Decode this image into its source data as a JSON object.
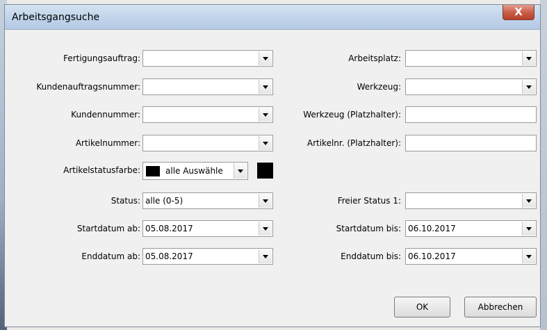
{
  "window": {
    "title": "Arbeitsgangsuche",
    "close_label": "X"
  },
  "left": {
    "fertigungsauftrag_label": "Fertigungsauftrag:",
    "kundenauftragsnummer_label": "Kundenauftragsnummer:",
    "kundennummer_label": "Kundennummer:",
    "artikelnummer_label": "Artikelnummer:",
    "artikelstatusfarbe_label": "Artikelstatusfarbe:",
    "artikelstatusfarbe_value": "alle Auswähle",
    "artikelstatusfarbe_swatch_color": "#000000",
    "status_label": "Status:",
    "status_value": "alle (0-5)",
    "startdatum_ab_label": "Startdatum ab:",
    "startdatum_ab_value": "05.08.2017",
    "enddatum_ab_label": "Enddatum ab:",
    "enddatum_ab_value": "05.08.2017"
  },
  "right": {
    "arbeitsplatz_label": "Arbeitsplatz:",
    "werkzeug_label": "Werkzeug:",
    "werkzeug_platzhalter_label": "Werkzeug (Platzhalter):",
    "artikelnr_platzhalter_label": "Artikelnr. (Platzhalter):",
    "freier_status_label": "Freier Status 1:",
    "startdatum_bis_label": "Startdatum bis:",
    "startdatum_bis_value": "06.10.2017",
    "enddatum_bis_label": "Enddatum bis:",
    "enddatum_bis_value": "06.10.2017"
  },
  "buttons": {
    "ok": "OK",
    "cancel": "Abbrechen"
  },
  "icons": {
    "close": "close-icon",
    "dropdown": "chevron-down-icon"
  }
}
